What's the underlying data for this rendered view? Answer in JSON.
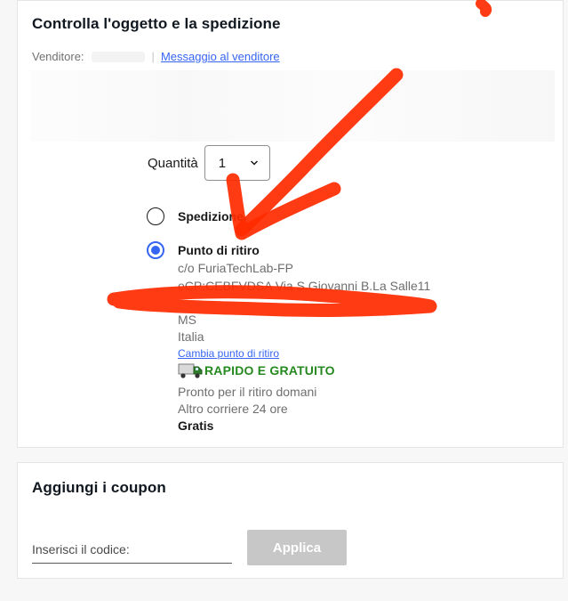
{
  "review": {
    "title": "Controlla l'oggetto e la spedizione",
    "seller_label": "Venditore:",
    "message_seller": "Messaggio al venditore",
    "quantity_label": "Quantità",
    "quantity_value": "1",
    "shipping_option": "Spedizione",
    "pickup_option": "Punto di ritiro",
    "address": [
      "c/o FuriaTechLab-FP",
      "eCP:CEBFVDSA Via S.Giovanni B.La Salle11",
      "",
      "MS",
      "Italia"
    ],
    "change_pickup": "Cambia punto di ritiro",
    "fast_free": "RAPIDO E GRATUITO",
    "ready": "Pronto per il ritiro domani",
    "courier": "Altro corriere 24 ore",
    "price": "Gratis"
  },
  "coupon": {
    "title": "Aggiungi i coupon",
    "input_placeholder": "Inserisci il codice:",
    "apply_label": "Applica"
  },
  "icons": {
    "truck": "truck-icon",
    "chevron": "chevron-down-icon"
  },
  "colors": {
    "link": "#3665f3",
    "radio_selected": "#3665f3",
    "fast_free": "#26891f",
    "annotation": "#ff2a00",
    "apply_disabled": "#c7c7c7"
  }
}
